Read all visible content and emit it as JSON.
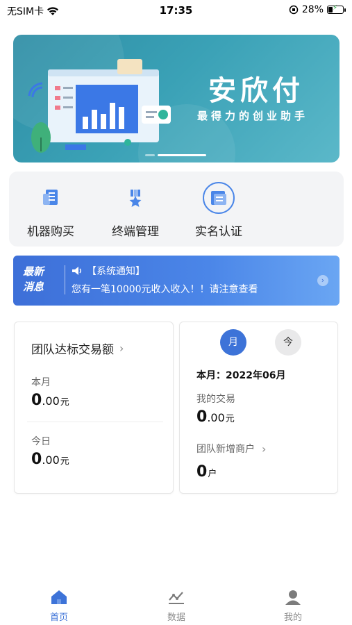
{
  "status_bar": {
    "carrier": "无SIM卡",
    "time": "17:35",
    "battery": "28%"
  },
  "banner": {
    "title": "安欣付",
    "subtitle": "最得力的创业助手"
  },
  "quick_menu": [
    {
      "label": "机器购买",
      "icon": "shopping-doc-icon"
    },
    {
      "label": "终端管理",
      "icon": "medal-icon"
    },
    {
      "label": "实名认证",
      "icon": "id-card-icon"
    }
  ],
  "notice": {
    "tag_line1": "最新",
    "tag_line2": "消息",
    "head": "【系统通知】",
    "text": "您有一笔10000元收入收入！！请注意查看"
  },
  "team_card": {
    "title": "团队达标交易额",
    "month_label": "本月",
    "month_value_int": "0",
    "month_value_dec": ".00",
    "month_unit": "元",
    "today_label": "今日",
    "today_value_int": "0",
    "today_value_dec": ".00",
    "today_unit": "元"
  },
  "stats_card": {
    "toggle_month": "月",
    "toggle_today": "今",
    "period": "本月：2022年06月",
    "my_trade_label": "我的交易",
    "my_trade_int": "0",
    "my_trade_dec": ".00",
    "my_trade_unit": "元",
    "new_merchants_label": "团队新增商户",
    "new_merchants_value": "0",
    "new_merchants_unit": "户"
  },
  "tabbar": [
    {
      "label": "首页",
      "icon": "home-icon",
      "active": true
    },
    {
      "label": "数据",
      "icon": "chart-icon",
      "active": false
    },
    {
      "label": "我的",
      "icon": "user-icon",
      "active": false
    }
  ],
  "colors": {
    "accent": "#3d73d8",
    "banner": "#3aa1b6",
    "notice": "#4b86e8"
  }
}
